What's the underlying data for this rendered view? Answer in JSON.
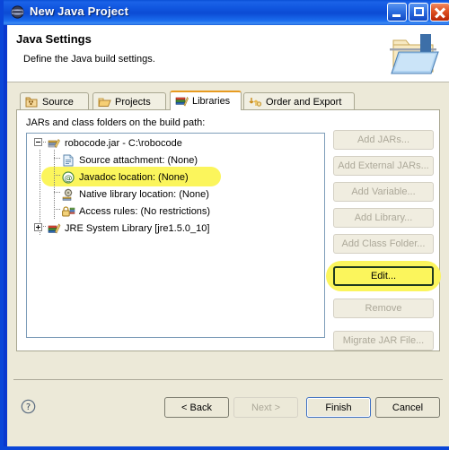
{
  "window": {
    "title": "New Java Project",
    "icon": "eclipse-globe-icon",
    "minimize_label": "Minimize",
    "maximize_label": "Maximize",
    "close_label": "Close"
  },
  "header": {
    "title": "Java Settings",
    "subtitle": "Define the Java build settings.",
    "icon": "java-folder-icon"
  },
  "tabs": [
    {
      "label": "Source",
      "icon": "source-folder-icon",
      "active": false
    },
    {
      "label": "Projects",
      "icon": "project-folder-icon",
      "active": false
    },
    {
      "label": "Libraries",
      "icon": "libraries-icon",
      "active": true
    },
    {
      "label": "Order and Export",
      "icon": "order-export-icon",
      "active": false
    }
  ],
  "panel": {
    "label": "JARs and class folders on the build path:"
  },
  "tree": [
    {
      "label": "robocode.jar - C:\\robocode",
      "icon": "jar-icon",
      "level": 0,
      "expander": "minus",
      "highlighted": false
    },
    {
      "label": "Source attachment: (None)",
      "icon": "source-doc-icon",
      "level": 1,
      "expander": "none",
      "highlighted": false
    },
    {
      "label": "Javadoc location: (None)",
      "icon": "javadoc-at-icon",
      "level": 1,
      "expander": "none",
      "highlighted": true
    },
    {
      "label": "Native library location: (None)",
      "icon": "native-lib-icon",
      "level": 1,
      "expander": "none",
      "highlighted": false
    },
    {
      "label": "Access rules: (No restrictions)",
      "icon": "access-lock-icon",
      "level": 1,
      "expander": "none",
      "highlighted": false
    },
    {
      "label": "JRE System Library [jre1.5.0_10]",
      "icon": "jre-lib-icon",
      "level": 0,
      "expander": "plus",
      "highlighted": false
    }
  ],
  "side_buttons": [
    {
      "label": "Add JARs...",
      "enabled": false,
      "highlighted": false
    },
    {
      "label": "Add External JARs...",
      "enabled": false,
      "highlighted": false
    },
    {
      "label": "Add Variable...",
      "enabled": false,
      "highlighted": false
    },
    {
      "label": "Add Library...",
      "enabled": false,
      "highlighted": false
    },
    {
      "label": "Add Class Folder...",
      "enabled": false,
      "highlighted": false
    },
    {
      "label": "Edit...",
      "enabled": true,
      "highlighted": true
    },
    {
      "label": "Remove",
      "enabled": false,
      "highlighted": false
    },
    {
      "label": "Migrate JAR File...",
      "enabled": false,
      "highlighted": false
    }
  ],
  "bottom": {
    "help_icon": "help-question-icon",
    "buttons": [
      {
        "label": "< Back",
        "enabled": true,
        "default": false
      },
      {
        "label": "Next >",
        "enabled": false,
        "default": false
      },
      {
        "label": "Finish",
        "enabled": true,
        "default": true
      },
      {
        "label": "Cancel",
        "enabled": true,
        "default": false
      }
    ]
  },
  "colors": {
    "titlebar_blue": "#1157E0",
    "dialog_bg": "#ECE9D8",
    "highlight_yellow": "#FBF55C",
    "active_tab_accent": "#E79B20",
    "tree_border": "#7E9DB9"
  }
}
